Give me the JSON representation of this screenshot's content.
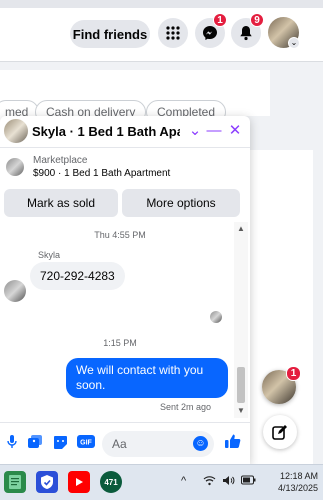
{
  "topbar": {
    "find_friends_label": "Find friends",
    "messenger_badge": "1",
    "notifications_badge": "9"
  },
  "background": {
    "chips": [
      "med",
      "Cash on delivery",
      "Completed"
    ]
  },
  "chat": {
    "title": "Skyla · 1 Bed 1 Bath Apart...",
    "marketplace_label": "Marketplace",
    "listing": "$900 · 1 Bed 1 Bath Apartment",
    "mark_as_sold_label": "Mark as sold",
    "more_options_label": "More options",
    "messages": {
      "timestamp_1": "Thu 4:55 PM",
      "sender_name": "Skyla",
      "incoming_text": "720-292-4283",
      "timestamp_2": "1:15 PM",
      "outgoing_text": "We will contact with you soon.",
      "sent_status": "Sent 2m ago"
    },
    "composer": {
      "placeholder": "Aa"
    }
  },
  "floating": {
    "chat_head_badge": "1"
  },
  "taskbar": {
    "time": "12:18 AM",
    "date": "4/13/2025",
    "badge_app_label": "471"
  },
  "colors": {
    "accent_blue": "#0866ff",
    "header_icon_purple": "#8b3dff",
    "badge_red": "#e41e3f"
  }
}
